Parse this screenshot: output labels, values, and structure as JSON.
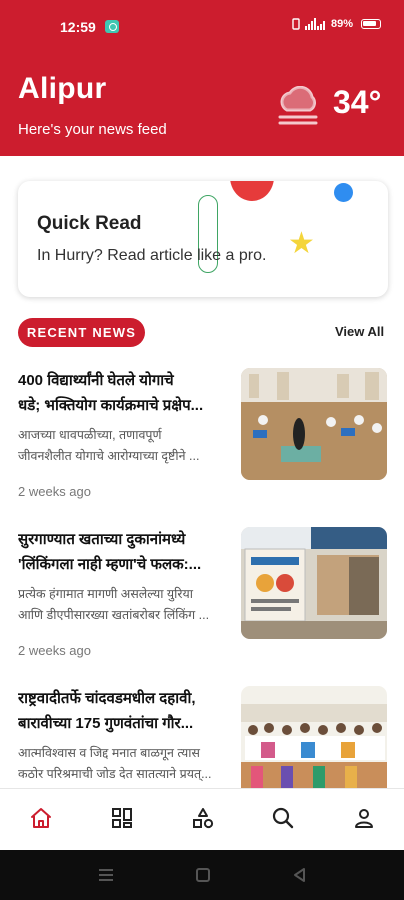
{
  "status_bar": {
    "time": "12:59",
    "battery": "89%"
  },
  "header": {
    "city": "Alipur",
    "subtitle": "Here's your news feed",
    "temperature": "34°",
    "weather_icon": "cloud-icon"
  },
  "quick_read": {
    "title": "Quick Read",
    "subtitle": "In Hurry? Read article like a pro."
  },
  "section": {
    "badge": "RECENT NEWS",
    "view_all": "View All"
  },
  "news": [
    {
      "title": "400 विद्यार्थ्यांनी घेतले योगाचे\nधडे; भक्तियोग कार्यक्रमाचे प्रक्षेप...",
      "snippet": "आजच्या धावपळीच्या, तणावपूर्ण\nजीवनशैलीत योगाचे आरोग्याच्या दृष्टीने ...",
      "time": "2 weeks ago"
    },
    {
      "title": "सुरगाण्यात खताच्या दुकानांमध्ये\n'लिंकिंगला नाही म्हणा'चे फलक:...",
      "snippet": "प्रत्येक हंगामात मागणी असलेल्या युरिया\nआणि डीएपीसारख्या खतांबरोबर लिंकिंग ...",
      "time": "2 weeks ago"
    },
    {
      "title": "राष्ट्रवादीतर्फे चांदवडमधील दहावी,\nबारावीच्या 175 गुणवंतांचा गौर...",
      "snippet": "आत्मविश्वास व जिद्द मनात बाळगून त्यास\nकठोर परिश्रमाची जोड देत सातत्याने प्रयत्...",
      "time": ""
    }
  ],
  "bottom_nav": [
    "home-icon",
    "grid-icon",
    "shapes-icon",
    "search-icon",
    "profile-icon"
  ],
  "colors": {
    "brand_red": "#cc1d2e",
    "white": "#ffffff"
  }
}
